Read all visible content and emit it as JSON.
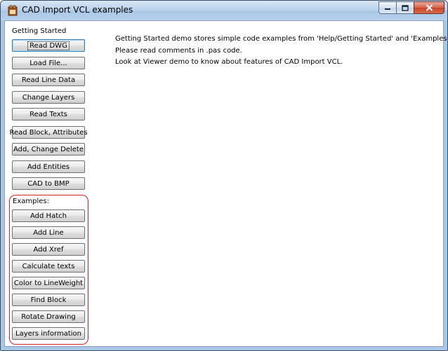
{
  "window": {
    "title": "CAD Import VCL examples",
    "icon": "cad-app-icon",
    "controls": [
      "minimize-icon",
      "maximize-icon",
      "close-icon"
    ]
  },
  "getting_started": {
    "label": "Getting Started",
    "buttons": [
      "Read DWG",
      "Load File...",
      "Read Line Data",
      "Change Layers",
      "Read Texts",
      "Read Block, Attributes",
      "Add, Change Delete",
      "Add Entities",
      "CAD to BMP"
    ]
  },
  "examples": {
    "label": "Examples:",
    "buttons": [
      "Add Hatch",
      "Add Line",
      "Add Xref",
      "Calculate texts",
      "Color to LineWeight",
      "Find Block",
      "Rotate Drawing",
      "Layers information"
    ]
  },
  "description": {
    "lines": [
      "Getting Started demo stores simple code examples from 'Help/Getting Started' and 'Examples' sections.",
      "Please read comments in .pas code.",
      "Look at Viewer demo to know about features of CAD Import VCL."
    ]
  },
  "colors": {
    "examples_frame": "#d42020",
    "focus": "#3c7fb1"
  }
}
